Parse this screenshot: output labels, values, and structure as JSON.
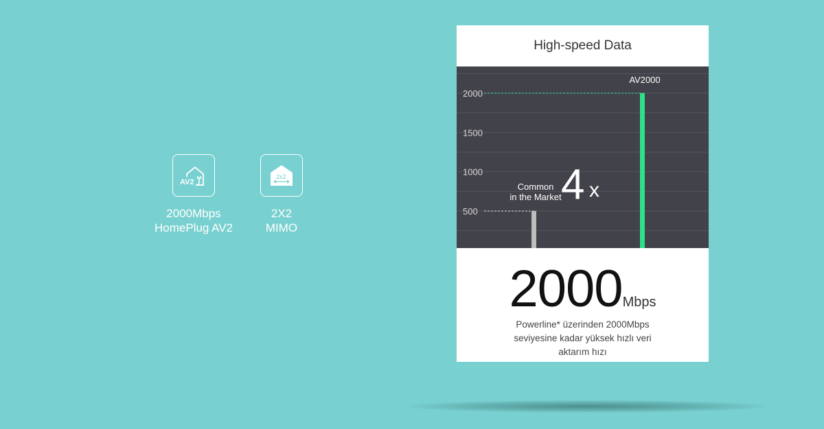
{
  "features": [
    {
      "icon": "av2-house-plug-icon",
      "icon_text": "AV2",
      "line1": "2000Mbps",
      "line2": "HomePlug AV2"
    },
    {
      "icon": "mimo-house-icon",
      "icon_text": "2x2",
      "line1": "2X2",
      "line2": "MIMO"
    }
  ],
  "card": {
    "title": "High-speed Data",
    "big_number": "2000",
    "big_unit": "Mbps",
    "description_lines": [
      "Powerline* üzerinden 2000Mbps",
      "seviyesine kadar yüksek hızlı veri",
      "aktarım hızı"
    ]
  },
  "chart_data": {
    "type": "bar",
    "yticks": [
      500,
      1000,
      1500,
      2000
    ],
    "ylim": [
      0,
      2200
    ],
    "grid": true,
    "series": [
      {
        "name": "Common in the Market",
        "value": 500,
        "color": "#bdbdbd"
      },
      {
        "name": "AV2000",
        "value": 2000,
        "color": "#2ee08a"
      }
    ],
    "annotations": {
      "common_line1": "Common",
      "common_line2": "in the Market",
      "multiplier": "4",
      "multiplier_suffix": "x",
      "av_label": "AV2000"
    }
  },
  "colors": {
    "background": "#79d0d0",
    "chart_bg": "#42424a",
    "accent_green": "#2ee08a"
  }
}
